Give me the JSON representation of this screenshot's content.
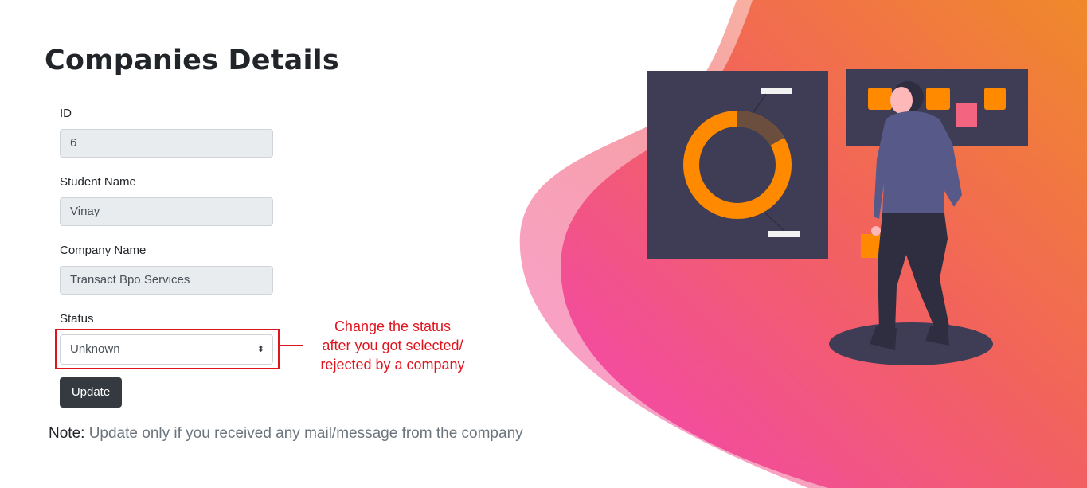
{
  "page": {
    "title": "Companies Details"
  },
  "form": {
    "id_label": "ID",
    "id_value": "6",
    "student_name_label": "Student Name",
    "student_name_value": "Vinay",
    "company_name_label": "Company Name",
    "company_name_value": "Transact Bpo Services",
    "status_label": "Status",
    "status_value": "Unknown",
    "update_label": "Update"
  },
  "annotation": {
    "line1": "Change the status",
    "line2": "after you got selected/",
    "line3": "rejected by a company"
  },
  "note": {
    "label": "Note:",
    "text": " Update only if you received any mail/message from the company"
  },
  "colors": {
    "annotation_red": "#e0141e",
    "button_dark": "#343a40",
    "blob_orange": "#f08a2c",
    "blob_pink": "#f34fb0",
    "panel_dark": "#3f3d56",
    "chart_orange": "#ff8a00"
  },
  "icons": {
    "select_arrow": "sort-arrows-icon"
  }
}
